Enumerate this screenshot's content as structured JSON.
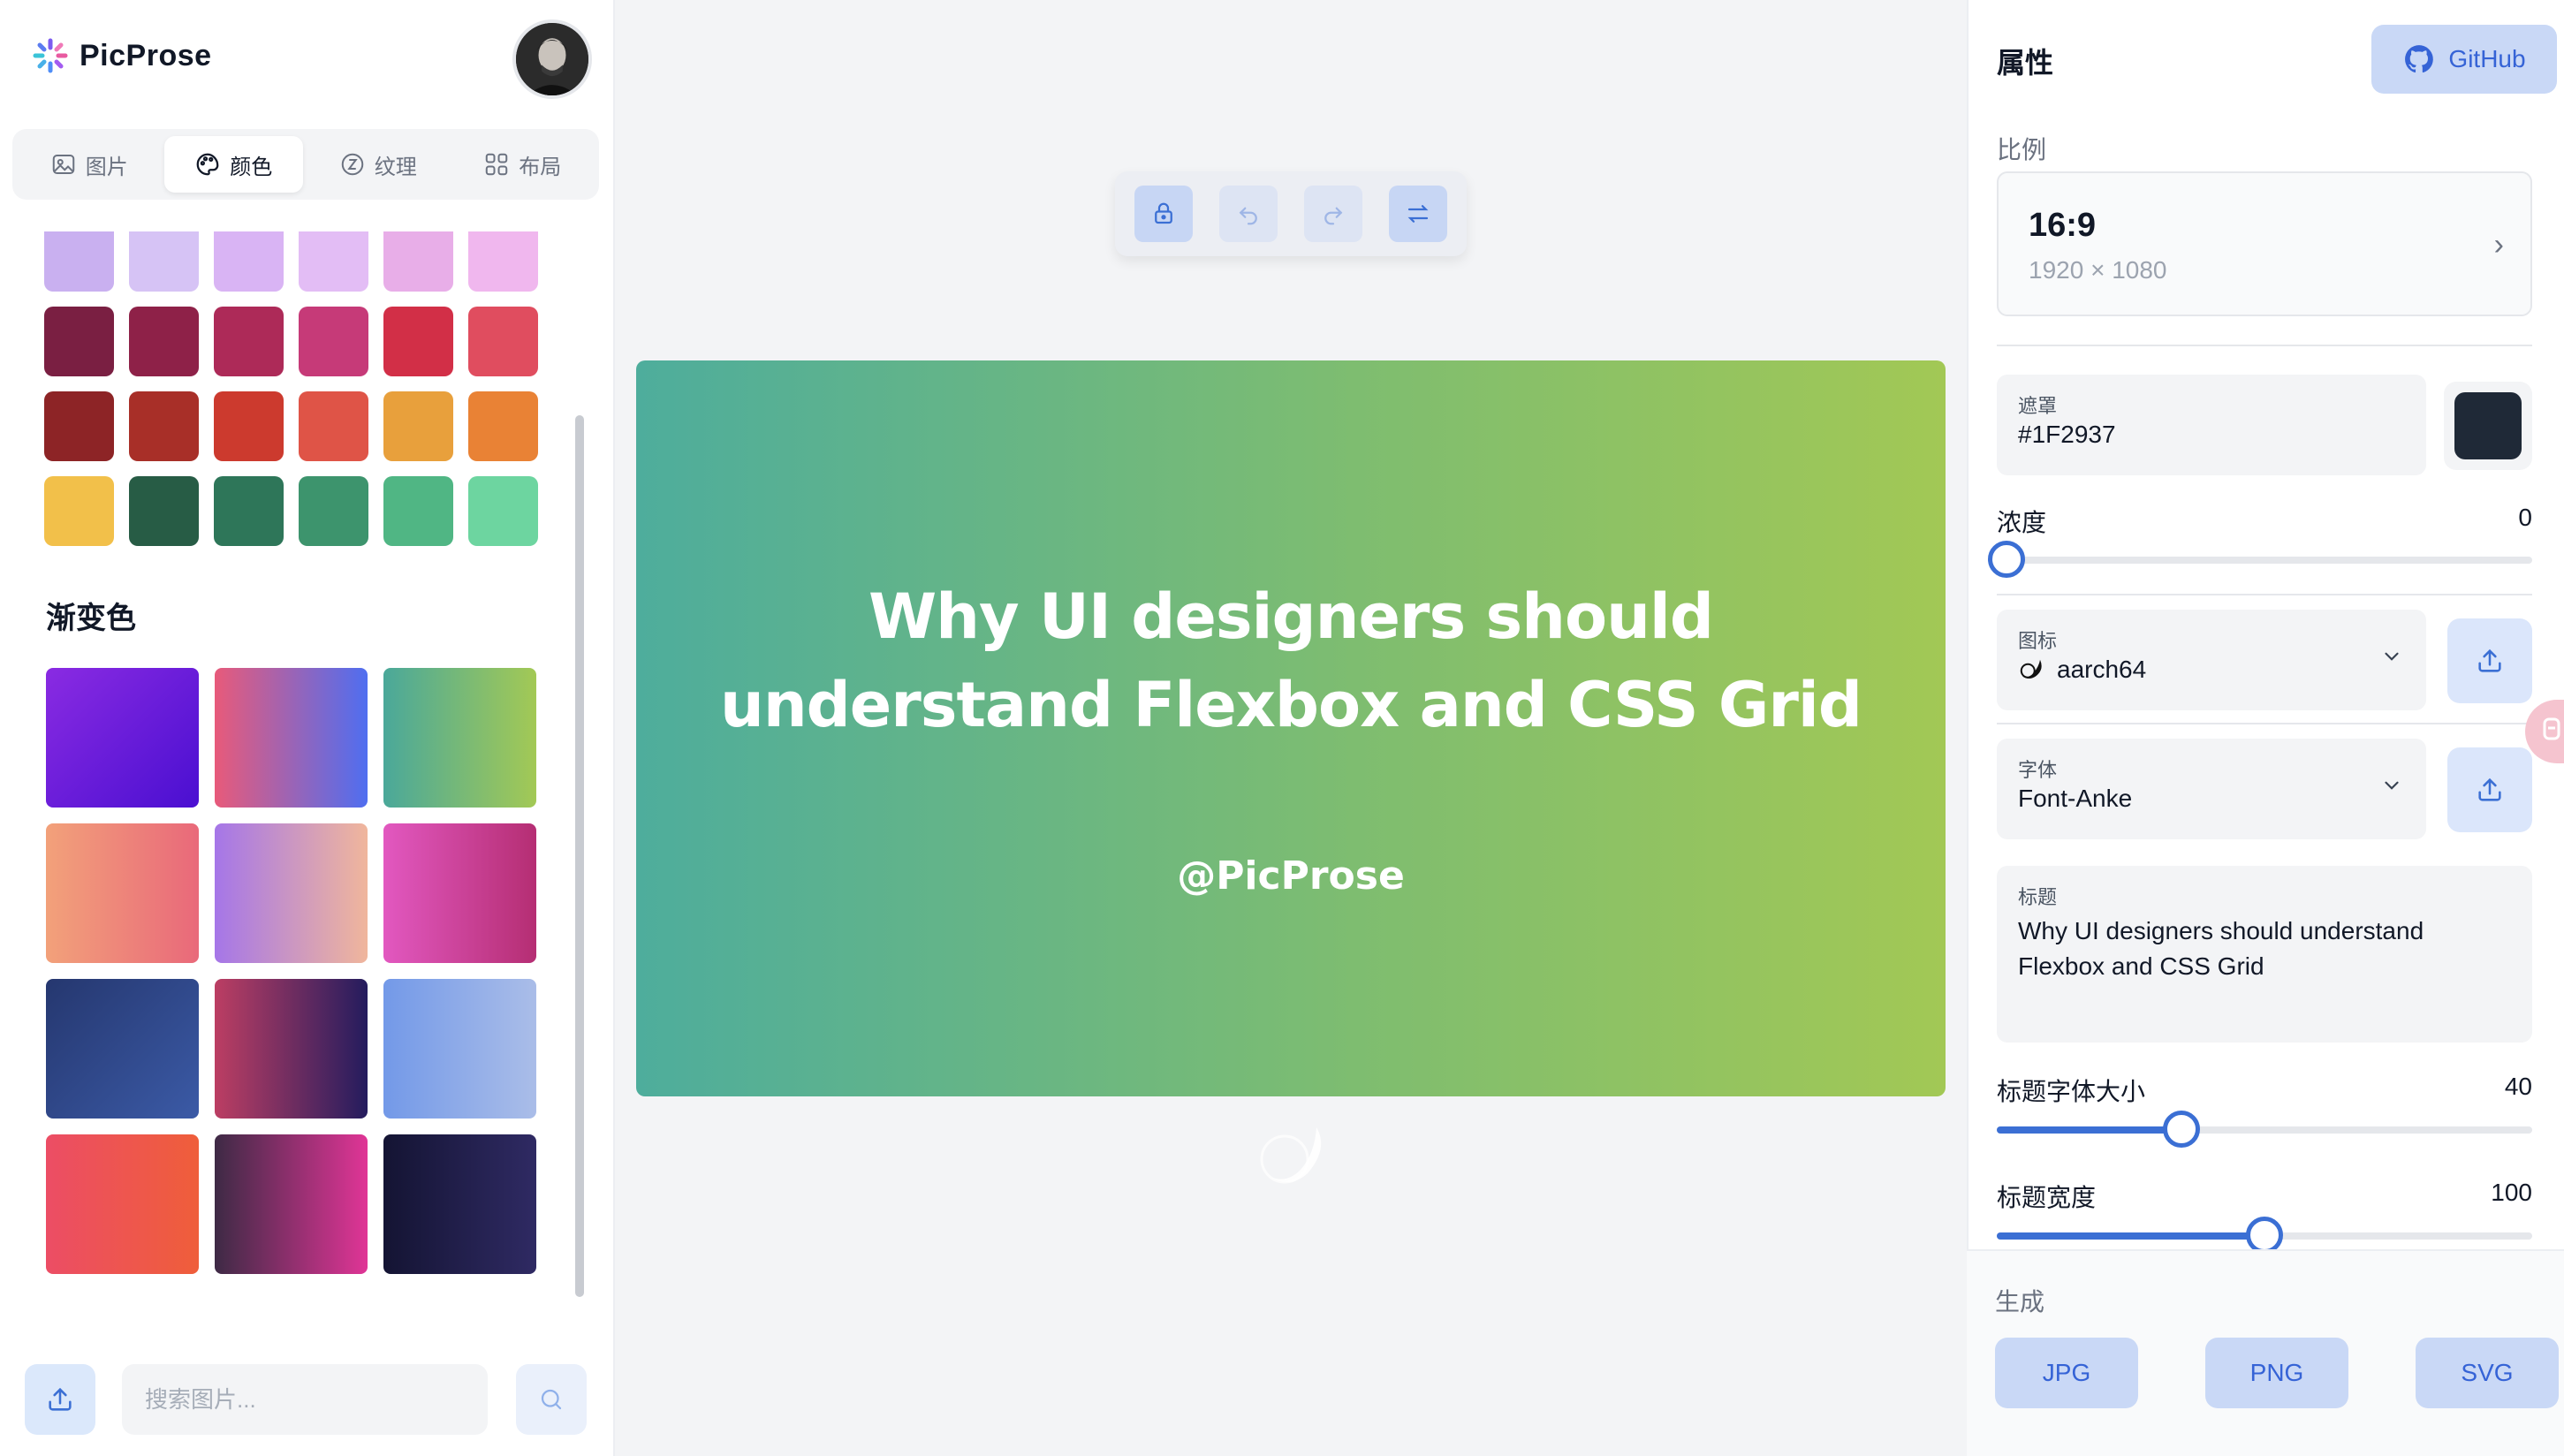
{
  "app": {
    "name": "PicProse"
  },
  "tabs": [
    {
      "label": "图片",
      "icon": "image-icon",
      "active": false
    },
    {
      "label": "颜色",
      "icon": "palette-icon",
      "active": true
    },
    {
      "label": "纹理",
      "icon": "texture-icon",
      "active": false
    },
    {
      "label": "布局",
      "icon": "layout-grid-icon",
      "active": false
    }
  ],
  "swatch_rows": [
    [
      "#c9b0f0",
      "#d6c3f5",
      "#d9b4f4",
      "#e3bdf5",
      "#e8aee8",
      "#f0b7ee"
    ],
    [
      "#7a1f42",
      "#8e2148",
      "#ad2a58",
      "#c63a78",
      "#d22f47",
      "#e04d5f"
    ],
    [
      "#8d2426",
      "#a82f28",
      "#cc3a2e",
      "#df5447",
      "#e8a03c",
      "#e98235"
    ],
    [
      "#f2c04a",
      "#275c45",
      "#2e7659",
      "#3d946d",
      "#50b684",
      "#6dd5a0"
    ]
  ],
  "gradients_title": "渐变色",
  "gradients": [
    [
      "linear-gradient(135deg,#8a2be2,#4a0fd1)",
      "linear-gradient(90deg,#e85a7a,#4f6ef0)",
      "linear-gradient(90deg,#4aa89a,#a3c955)"
    ],
    [
      "linear-gradient(90deg,#f2a17a,#e9697a)",
      "linear-gradient(90deg,#a576e8,#f0b69c)",
      "linear-gradient(90deg,#e258c0,#b52e73)"
    ],
    [
      "linear-gradient(135deg,#25376f,#3b5aa6)",
      "linear-gradient(90deg,#bc3e63,#241c5e)",
      "linear-gradient(90deg,#7399e8,#aabde8)"
    ],
    [
      "linear-gradient(90deg,#ec4d65,#ef5e3a)",
      "linear-gradient(90deg,#3e2a45,#e03596)",
      "linear-gradient(90deg,#141433,#2f2a63)"
    ]
  ],
  "search": {
    "placeholder": "搜索图片..."
  },
  "canvas": {
    "title": "Why UI designers should understand Flexbox and CSS Grid",
    "author": "@PicProse"
  },
  "panel": {
    "title": "属性",
    "github_label": "GitHub",
    "ratio_label": "比例",
    "ratio_value": "16:9",
    "ratio_size": "1920 × 1080",
    "mask_label": "遮罩",
    "mask_value": "#1F2937",
    "mask_color": "#1f2937",
    "opacity_label": "浓度",
    "opacity_value": "0",
    "icon_label": "图标",
    "icon_value": "aarch64",
    "font_label": "字体",
    "font_value": "Font-Anke",
    "heading_label": "标题",
    "heading_value": "Why UI designers should understand\nFlexbox and CSS Grid",
    "heading_size_label": "标题字体大小",
    "heading_size_value": "40",
    "heading_size_fraction": 0.345,
    "heading_width_label": "标题宽度",
    "heading_width_value": "100",
    "heading_width_fraction": 0.5,
    "opacity_fraction": 0
  },
  "generate": {
    "label": "生成",
    "buttons": [
      "JPG",
      "PNG",
      "SVG"
    ]
  }
}
